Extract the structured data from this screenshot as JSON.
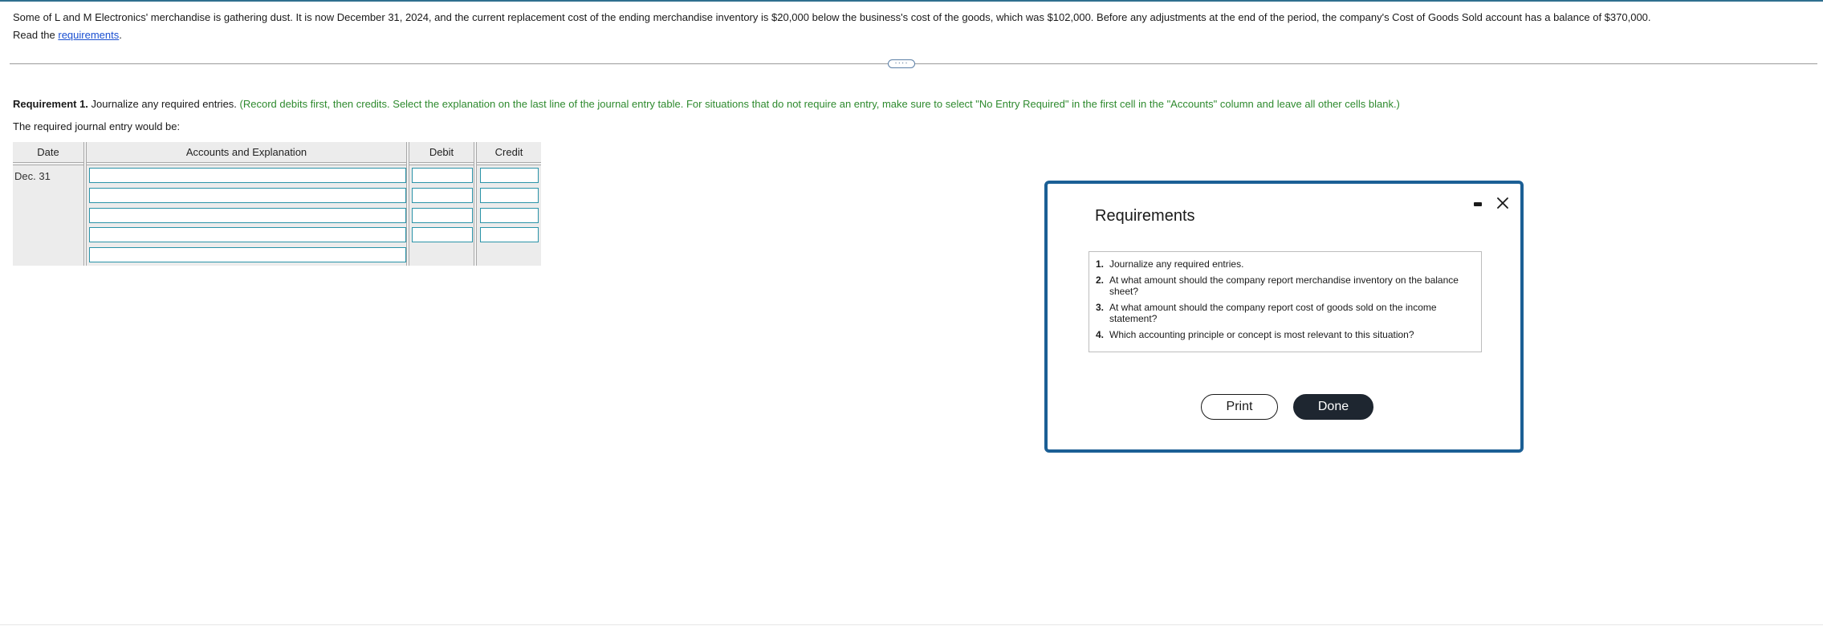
{
  "problem": {
    "text": "Some of L and M Electronics' merchandise is gathering dust. It is now December 31, 2024, and the current replacement cost of the ending merchandise inventory is $20,000 below the business's cost of the goods, which was $102,000. Before any adjustments at the end of the period, the company's Cost of Goods Sold account has a balance of $370,000.",
    "read_prefix": "Read the ",
    "read_link": "requirements",
    "read_suffix": "."
  },
  "requirement1": {
    "label": "Requirement 1.",
    "task": " Journalize any required entries. ",
    "instruction": "(Record debits first, then credits. Select the explanation on the last line of the journal entry table. For situations that do not require an entry, make sure to select \"No Entry Required\" in the first cell in the \"Accounts\" column and leave all other cells blank.)",
    "entry_intro": "The required journal entry would be:"
  },
  "journal": {
    "headers": {
      "date": "Date",
      "accounts": "Accounts and Explanation",
      "debit": "Debit",
      "credit": "Credit"
    },
    "date": "Dec. 31",
    "rows": [
      {
        "account": "",
        "debit": "",
        "credit": ""
      },
      {
        "account": "",
        "debit": "",
        "credit": ""
      },
      {
        "account": "",
        "debit": "",
        "credit": ""
      },
      {
        "account": "",
        "debit": "",
        "credit": ""
      },
      {
        "account": ""
      }
    ]
  },
  "modal": {
    "title": "Requirements",
    "items": [
      {
        "num": "1.",
        "text": "Journalize any required entries."
      },
      {
        "num": "2.",
        "text": "At what amount should the company report merchandise inventory on the balance sheet?"
      },
      {
        "num": "3.",
        "text": "At what amount should the company report cost of goods sold on the income statement?"
      },
      {
        "num": "4.",
        "text": "Which accounting principle or concept is most relevant to this situation?"
      }
    ],
    "print_label": "Print",
    "done_label": "Done"
  },
  "divider_handle": "····",
  "colors": {
    "accent": "#2e8a2e",
    "cell_border": "#2a93a8",
    "modal_border": "#1b5f95",
    "done_bg": "#1e2630",
    "link": "#1a4fd1"
  }
}
